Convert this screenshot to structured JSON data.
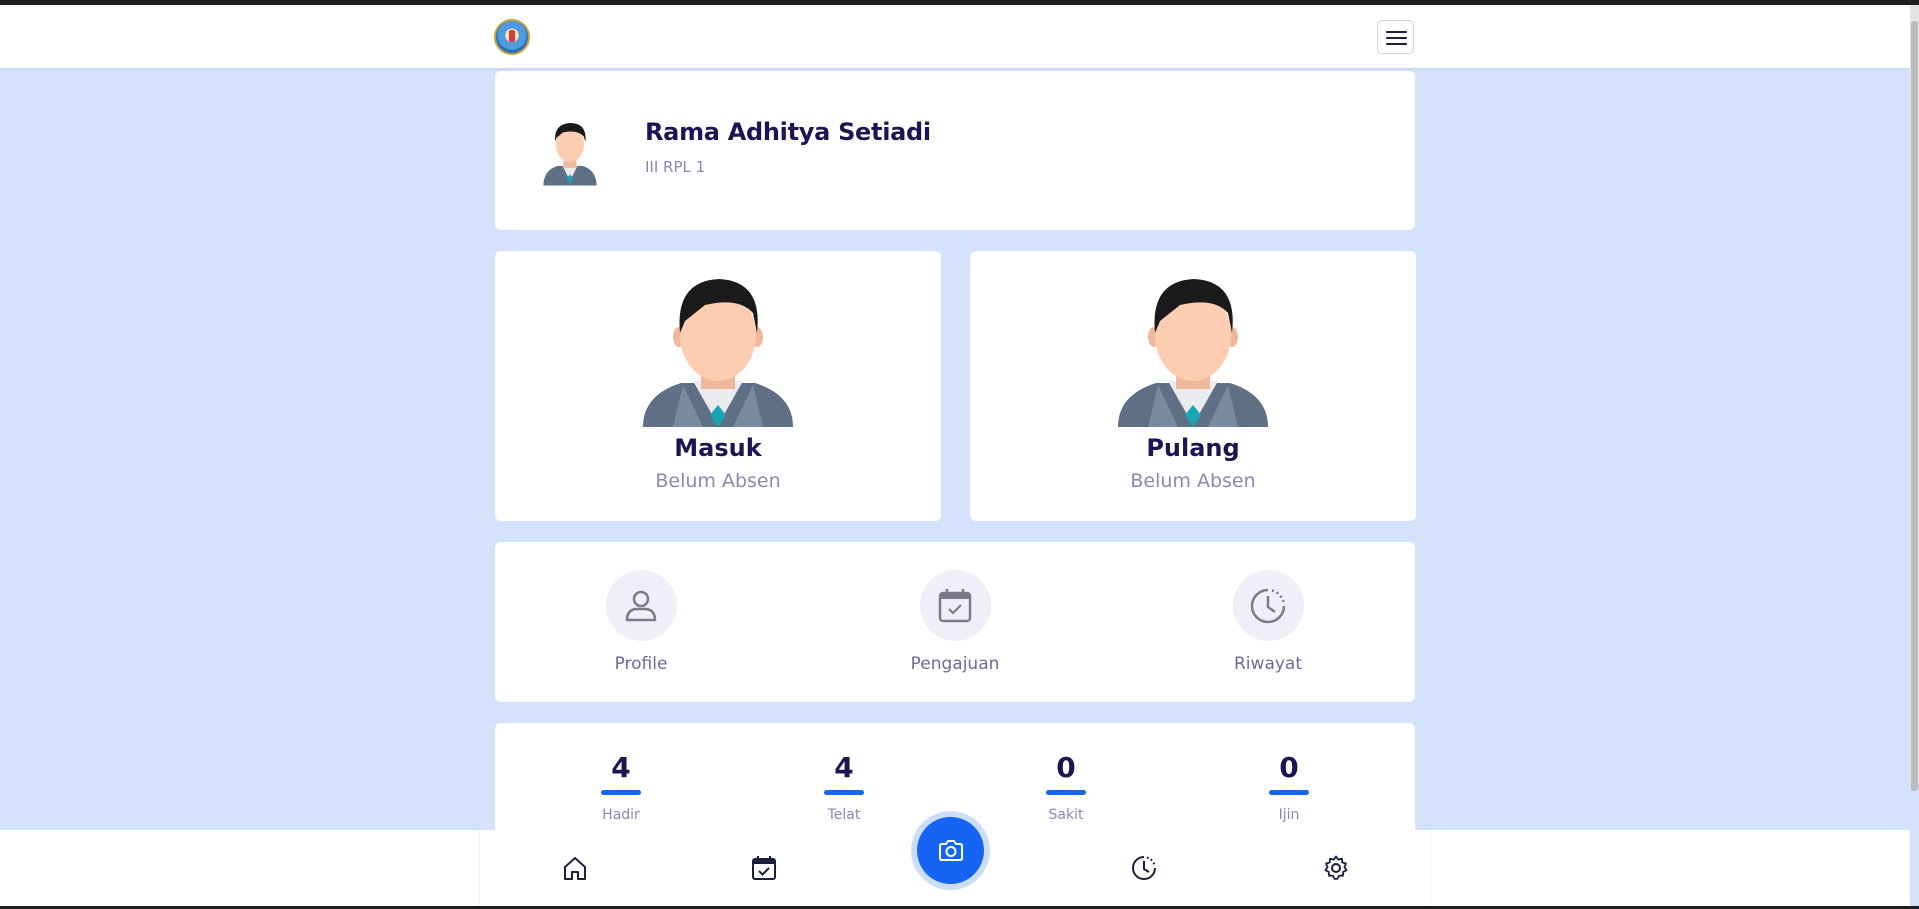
{
  "navbar": {
    "logo_icon": "school-logo-icon",
    "menu_icon": "hamburger-menu-icon"
  },
  "profile": {
    "name": "Rama Adhitya Setiadi",
    "class": "III RPL 1"
  },
  "attendance": [
    {
      "title": "Masuk",
      "status": "Belum Absen"
    },
    {
      "title": "Pulang",
      "status": "Belum Absen"
    }
  ],
  "menu": [
    {
      "label": "Profile",
      "icon": "user-icon"
    },
    {
      "label": "Pengajuan",
      "icon": "calendar-check-icon"
    },
    {
      "label": "Riwayat",
      "icon": "clock-history-icon"
    }
  ],
  "stats": [
    {
      "value": "4",
      "label": "Hadir"
    },
    {
      "value": "4",
      "label": "Telat"
    },
    {
      "value": "0",
      "label": "Sakit"
    },
    {
      "value": "0",
      "label": "Ijin"
    }
  ],
  "bottom_nav": [
    {
      "icon": "home-icon"
    },
    {
      "icon": "calendar-check-icon"
    },
    {
      "icon": "camera-icon"
    },
    {
      "icon": "clock-history-icon"
    },
    {
      "icon": "gear-icon"
    }
  ],
  "colors": {
    "accent": "#1564f3",
    "background": "#d3e2fa",
    "heading": "#1d1553",
    "muted": "#8a88b2"
  }
}
